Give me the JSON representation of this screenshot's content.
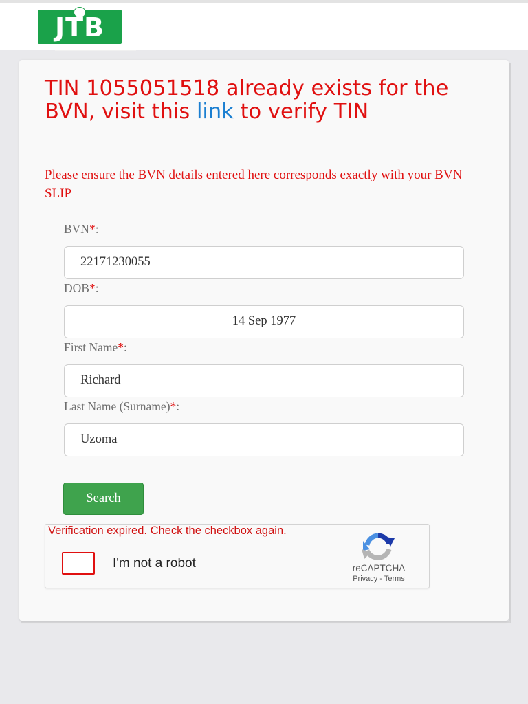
{
  "header": {
    "logo_text": "JTB"
  },
  "message": {
    "title_before": "TIN 1055051518 already exists for the BVN, visit this ",
    "title_link": "link",
    "title_after": " to verify TIN",
    "notice": "Please ensure the BVN details entered here corresponds exactly with your BVN SLIP"
  },
  "form": {
    "required_mark": "*",
    "fields": [
      {
        "label": "BVN",
        "value": "22171230055"
      },
      {
        "label": "DOB",
        "value": "14 Sep 1977"
      },
      {
        "label": "First Name",
        "value": "Richard"
      },
      {
        "label": "Last Name (Surname)",
        "value": "Uzoma"
      }
    ],
    "label_suffix": ":",
    "search_button": "Search"
  },
  "captcha": {
    "error": "Verification expired. Check the checkbox again.",
    "label": "I'm not a robot",
    "brand": "reCAPTCHA",
    "privacy": "Privacy",
    "separator": " - ",
    "terms": "Terms"
  },
  "colors": {
    "error_red": "#e01010",
    "link_blue": "#1b7fd1",
    "button_green": "#3fa34d",
    "logo_green": "#1aa24a"
  }
}
